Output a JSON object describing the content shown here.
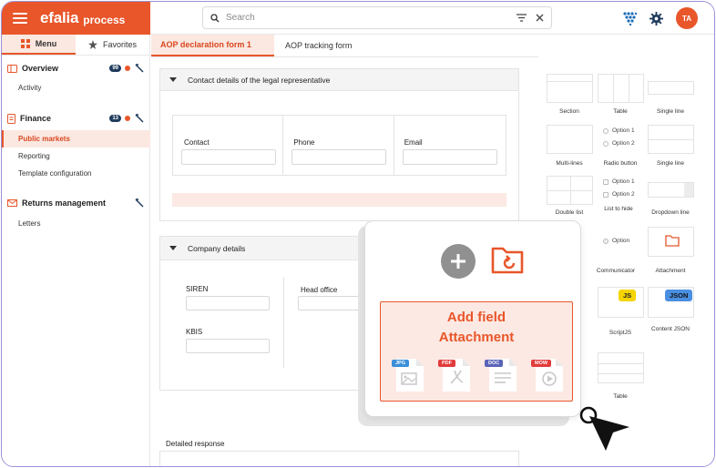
{
  "app": {
    "brand": "efalia",
    "brand_sub": "process",
    "avatar_initials": "TA",
    "accent_color": "#e8562a",
    "badge_color": "#1f3b5c"
  },
  "search": {
    "placeholder": "Search"
  },
  "sidebar": {
    "tabs": [
      {
        "label": "Menu",
        "icon": "grid-icon",
        "active": true
      },
      {
        "label": "Favorites",
        "icon": "star-icon",
        "active": false
      }
    ],
    "sections": [
      {
        "label": "Overview",
        "icon": "overview-icon",
        "badge": "99",
        "items": [
          {
            "label": "Activity",
            "active": false
          }
        ]
      },
      {
        "label": "Finance",
        "icon": "finance-icon",
        "badge": "13",
        "items": [
          {
            "label": "Public markets",
            "active": true
          },
          {
            "label": "Reporting",
            "active": false
          },
          {
            "label": "Template configuration",
            "active": false
          }
        ]
      },
      {
        "label": "Returns management",
        "icon": "mail-icon",
        "badge": "",
        "items": [
          {
            "label": "Letters",
            "active": false
          }
        ]
      }
    ]
  },
  "main": {
    "tabs": [
      {
        "label": "AOP declaration form 1",
        "active": true
      },
      {
        "label": "AOP tracking form",
        "active": false
      }
    ],
    "panel_contact": {
      "title": "Contact details of the legal representative",
      "fields": [
        {
          "label": "Contact",
          "value": ""
        },
        {
          "label": "Phone",
          "value": ""
        },
        {
          "label": "Email",
          "value": ""
        }
      ]
    },
    "panel_company": {
      "title": "Company details",
      "fields": [
        {
          "label": "SIREN",
          "value": ""
        },
        {
          "label": "KBIS",
          "value": ""
        },
        {
          "label": "Head office",
          "value": ""
        }
      ]
    },
    "detailed_response": {
      "label": "Detailed response"
    }
  },
  "palette": {
    "items": [
      {
        "label": "Section"
      },
      {
        "label": "Table"
      },
      {
        "label": "Single line"
      },
      {
        "label": "Multi-lines"
      },
      {
        "label": "Radio button"
      },
      {
        "label": "Single line"
      },
      {
        "label": "Double list"
      },
      {
        "label": "List to hide"
      },
      {
        "label": "Dropdown line"
      },
      {
        "label": "Communicator"
      },
      {
        "label": "Attachment"
      },
      {
        "label": "ScriptJS"
      },
      {
        "label": "Content JSON"
      },
      {
        "label": "Table"
      }
    ],
    "option1": "Option 1",
    "option2": "Option 2",
    "option": "Option",
    "js_chip": "JS",
    "json_chip": "JSON"
  },
  "overlay": {
    "title_line1": "Add field",
    "title_line2": "Attachment",
    "file_types": [
      {
        "label": "JPG",
        "color": "#3b8fd9"
      },
      {
        "label": "PDF",
        "color": "#e33b3b"
      },
      {
        "label": "DOC",
        "color": "#5a63b8"
      },
      {
        "label": "MOW",
        "color": "#e33b3b"
      }
    ]
  }
}
